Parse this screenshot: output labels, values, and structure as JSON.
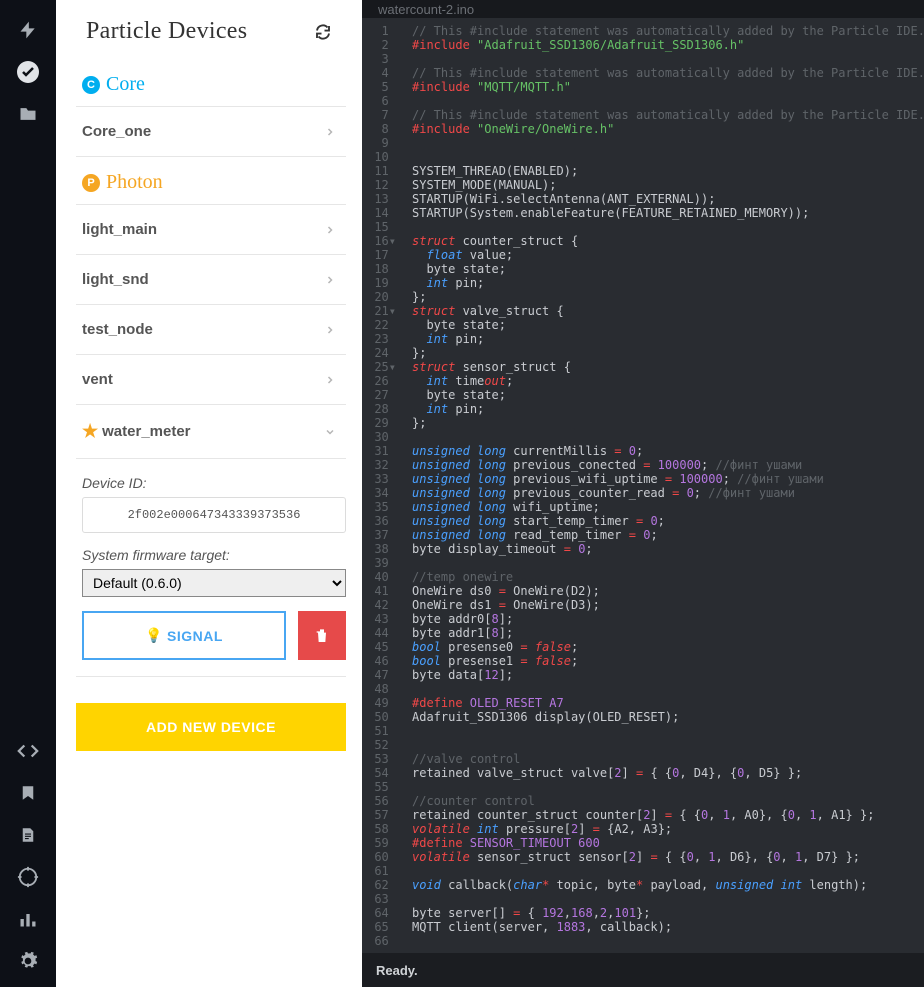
{
  "sidebar": {
    "title": "Particle Devices",
    "platforms": [
      {
        "key": "core",
        "label": "Core",
        "badge": "C",
        "devices": [
          {
            "name": "Core_one",
            "starred": false,
            "expanded": false
          }
        ]
      },
      {
        "key": "photon",
        "label": "Photon",
        "badge": "P",
        "devices": [
          {
            "name": "light_main",
            "starred": false,
            "expanded": false
          },
          {
            "name": "light_snd",
            "starred": false,
            "expanded": false
          },
          {
            "name": "test_node",
            "starred": false,
            "expanded": false
          },
          {
            "name": "vent",
            "starred": false,
            "expanded": false
          },
          {
            "name": "water_meter",
            "starred": true,
            "expanded": true
          }
        ]
      }
    ],
    "device_detail": {
      "device_id_label": "Device ID:",
      "device_id": "2f002e000647343339373536",
      "firmware_label": "System firmware target:",
      "firmware_value": "Default (0.6.0)",
      "signal_label": "SIGNAL",
      "add_label": "ADD NEW DEVICE"
    }
  },
  "editor": {
    "tab_title": "watercount-2.ino",
    "status": "Ready.",
    "code_lines": [
      {
        "n": 1,
        "seg": [
          [
            "c-comment",
            "// This #include statement was automatically added by the Particle IDE."
          ]
        ]
      },
      {
        "n": 2,
        "seg": [
          [
            "c-include",
            "#include "
          ],
          [
            "c-string",
            "\"Adafruit_SSD1306/Adafruit_SSD1306.h\""
          ]
        ]
      },
      {
        "n": 3,
        "seg": []
      },
      {
        "n": 4,
        "seg": [
          [
            "c-comment",
            "// This #include statement was automatically added by the Particle IDE."
          ]
        ]
      },
      {
        "n": 5,
        "seg": [
          [
            "c-include",
            "#include "
          ],
          [
            "c-string",
            "\"MQTT/MQTT.h\""
          ]
        ]
      },
      {
        "n": 6,
        "seg": []
      },
      {
        "n": 7,
        "seg": [
          [
            "c-comment",
            "// This #include statement was automatically added by the Particle IDE."
          ]
        ]
      },
      {
        "n": 8,
        "seg": [
          [
            "c-include",
            "#include "
          ],
          [
            "c-string",
            "\"OneWire/OneWire.h\""
          ]
        ]
      },
      {
        "n": 9,
        "seg": []
      },
      {
        "n": 10,
        "seg": []
      },
      {
        "n": 11,
        "seg": [
          [
            "",
            "SYSTEM_THREAD(ENABLED);"
          ]
        ]
      },
      {
        "n": 12,
        "seg": [
          [
            "",
            "SYSTEM_MODE(MANUAL);"
          ]
        ]
      },
      {
        "n": 13,
        "seg": [
          [
            "",
            "STARTUP(WiFi.selectAntenna(ANT_EXTERNAL));"
          ]
        ]
      },
      {
        "n": 14,
        "seg": [
          [
            "",
            "STARTUP(System.enableFeature(FEATURE_RETAINED_MEMORY));"
          ]
        ]
      },
      {
        "n": 15,
        "seg": []
      },
      {
        "n": 16,
        "fold": true,
        "seg": [
          [
            "c-keyword",
            "struct"
          ],
          [
            "",
            " counter_struct {"
          ]
        ]
      },
      {
        "n": 17,
        "seg": [
          [
            "",
            "  "
          ],
          [
            "c-type",
            "float"
          ],
          [
            "",
            " value;"
          ]
        ]
      },
      {
        "n": 18,
        "seg": [
          [
            "",
            "  byte state;"
          ]
        ]
      },
      {
        "n": 19,
        "seg": [
          [
            "",
            "  "
          ],
          [
            "c-type",
            "int"
          ],
          [
            "",
            " pin;"
          ]
        ]
      },
      {
        "n": 20,
        "seg": [
          [
            "",
            "};"
          ]
        ]
      },
      {
        "n": 21,
        "fold": true,
        "seg": [
          [
            "c-keyword",
            "struct"
          ],
          [
            "",
            " valve_struct {"
          ]
        ]
      },
      {
        "n": 22,
        "seg": [
          [
            "",
            "  byte state;"
          ]
        ]
      },
      {
        "n": 23,
        "seg": [
          [
            "",
            "  "
          ],
          [
            "c-type",
            "int"
          ],
          [
            "",
            " pin;"
          ]
        ]
      },
      {
        "n": 24,
        "seg": [
          [
            "",
            "};"
          ]
        ]
      },
      {
        "n": 25,
        "fold": true,
        "seg": [
          [
            "c-keyword",
            "struct"
          ],
          [
            "",
            " sensor_struct {"
          ]
        ]
      },
      {
        "n": 26,
        "seg": [
          [
            "",
            "  "
          ],
          [
            "c-type",
            "int"
          ],
          [
            "",
            " time"
          ],
          [
            "c-keyword",
            "out"
          ],
          [
            "",
            ";"
          ]
        ]
      },
      {
        "n": 27,
        "seg": [
          [
            "",
            "  byte state;"
          ]
        ]
      },
      {
        "n": 28,
        "seg": [
          [
            "",
            "  "
          ],
          [
            "c-type",
            "int"
          ],
          [
            "",
            " pin;"
          ]
        ]
      },
      {
        "n": 29,
        "seg": [
          [
            "",
            "};"
          ]
        ]
      },
      {
        "n": 30,
        "seg": []
      },
      {
        "n": 31,
        "seg": [
          [
            "c-type",
            "unsigned long"
          ],
          [
            "",
            " currentMillis "
          ],
          [
            "c-op",
            "="
          ],
          [
            "",
            " "
          ],
          [
            "c-num",
            "0"
          ],
          [
            "",
            ";"
          ]
        ]
      },
      {
        "n": 32,
        "seg": [
          [
            "c-type",
            "unsigned long"
          ],
          [
            "",
            " previous_conected "
          ],
          [
            "c-op",
            "="
          ],
          [
            "",
            " "
          ],
          [
            "c-num",
            "100000"
          ],
          [
            "",
            "; "
          ],
          [
            "c-comment",
            "//финт ушами"
          ]
        ]
      },
      {
        "n": 33,
        "seg": [
          [
            "c-type",
            "unsigned long"
          ],
          [
            "",
            " previous_wifi_uptime "
          ],
          [
            "c-op",
            "="
          ],
          [
            "",
            " "
          ],
          [
            "c-num",
            "100000"
          ],
          [
            "",
            "; "
          ],
          [
            "c-comment",
            "//финт ушами"
          ]
        ]
      },
      {
        "n": 34,
        "seg": [
          [
            "c-type",
            "unsigned long"
          ],
          [
            "",
            " previous_counter_read "
          ],
          [
            "c-op",
            "="
          ],
          [
            "",
            " "
          ],
          [
            "c-num",
            "0"
          ],
          [
            "",
            "; "
          ],
          [
            "c-comment",
            "//финт ушами"
          ]
        ]
      },
      {
        "n": 35,
        "seg": [
          [
            "c-type",
            "unsigned long"
          ],
          [
            "",
            " wifi_uptime;"
          ]
        ]
      },
      {
        "n": 36,
        "seg": [
          [
            "c-type",
            "unsigned long"
          ],
          [
            "",
            " start_temp_timer "
          ],
          [
            "c-op",
            "="
          ],
          [
            "",
            " "
          ],
          [
            "c-num",
            "0"
          ],
          [
            "",
            ";"
          ]
        ]
      },
      {
        "n": 37,
        "seg": [
          [
            "c-type",
            "unsigned long"
          ],
          [
            "",
            " read_temp_timer "
          ],
          [
            "c-op",
            "="
          ],
          [
            "",
            " "
          ],
          [
            "c-num",
            "0"
          ],
          [
            "",
            ";"
          ]
        ]
      },
      {
        "n": 38,
        "seg": [
          [
            "",
            "byte display_timeout "
          ],
          [
            "c-op",
            "="
          ],
          [
            "",
            " "
          ],
          [
            "c-num",
            "0"
          ],
          [
            "",
            ";"
          ]
        ]
      },
      {
        "n": 39,
        "seg": []
      },
      {
        "n": 40,
        "seg": [
          [
            "c-comment",
            "//temp onewire"
          ]
        ]
      },
      {
        "n": 41,
        "seg": [
          [
            "",
            "OneWire ds0 "
          ],
          [
            "c-op",
            "="
          ],
          [
            "",
            " OneWire(D2);"
          ]
        ]
      },
      {
        "n": 42,
        "seg": [
          [
            "",
            "OneWire ds1 "
          ],
          [
            "c-op",
            "="
          ],
          [
            "",
            " OneWire(D3);"
          ]
        ]
      },
      {
        "n": 43,
        "seg": [
          [
            "",
            "byte addr0["
          ],
          [
            "c-num",
            "8"
          ],
          [
            "",
            "];"
          ]
        ]
      },
      {
        "n": 44,
        "seg": [
          [
            "",
            "byte addr1["
          ],
          [
            "c-num",
            "8"
          ],
          [
            "",
            "];"
          ]
        ]
      },
      {
        "n": 45,
        "seg": [
          [
            "c-type",
            "bool"
          ],
          [
            "",
            " presense0 "
          ],
          [
            "c-op",
            "="
          ],
          [
            "",
            " "
          ],
          [
            "c-keyword",
            "false"
          ],
          [
            "",
            ";"
          ]
        ]
      },
      {
        "n": 46,
        "seg": [
          [
            "c-type",
            "bool"
          ],
          [
            "",
            " presense1 "
          ],
          [
            "c-op",
            "="
          ],
          [
            "",
            " "
          ],
          [
            "c-keyword",
            "false"
          ],
          [
            "",
            ";"
          ]
        ]
      },
      {
        "n": 47,
        "seg": [
          [
            "",
            "byte data["
          ],
          [
            "c-num",
            "12"
          ],
          [
            "",
            "];"
          ]
        ]
      },
      {
        "n": 48,
        "seg": []
      },
      {
        "n": 49,
        "seg": [
          [
            "c-define",
            "#define "
          ],
          [
            "c-num",
            "OLED_RESET A7"
          ]
        ]
      },
      {
        "n": 50,
        "seg": [
          [
            "",
            "Adafruit_SSD1306 display(OLED_RESET);"
          ]
        ]
      },
      {
        "n": 51,
        "seg": []
      },
      {
        "n": 52,
        "seg": []
      },
      {
        "n": 53,
        "seg": [
          [
            "c-comment",
            "//valve control"
          ]
        ]
      },
      {
        "n": 54,
        "seg": [
          [
            "",
            "retained valve_struct valve["
          ],
          [
            "c-num",
            "2"
          ],
          [
            "",
            "] "
          ],
          [
            "c-op",
            "="
          ],
          [
            "",
            " { {"
          ],
          [
            "c-num",
            "0"
          ],
          [
            "",
            ", D4}, {"
          ],
          [
            "c-num",
            "0"
          ],
          [
            "",
            ", D5} };"
          ]
        ]
      },
      {
        "n": 55,
        "seg": []
      },
      {
        "n": 56,
        "seg": [
          [
            "c-comment",
            "//counter control"
          ]
        ]
      },
      {
        "n": 57,
        "seg": [
          [
            "",
            "retained counter_struct counter["
          ],
          [
            "c-num",
            "2"
          ],
          [
            "",
            "] "
          ],
          [
            "c-op",
            "="
          ],
          [
            "",
            " { {"
          ],
          [
            "c-num",
            "0"
          ],
          [
            "",
            ", "
          ],
          [
            "c-num",
            "1"
          ],
          [
            "",
            ", A0}, {"
          ],
          [
            "c-num",
            "0"
          ],
          [
            "",
            ", "
          ],
          [
            "c-num",
            "1"
          ],
          [
            "",
            ", A1} };"
          ]
        ]
      },
      {
        "n": 58,
        "seg": [
          [
            "c-keyword",
            "volatile"
          ],
          [
            "",
            " "
          ],
          [
            "c-type",
            "int"
          ],
          [
            "",
            " pressure["
          ],
          [
            "c-num",
            "2"
          ],
          [
            "",
            "] "
          ],
          [
            "c-op",
            "="
          ],
          [
            "",
            " {A2, A3};"
          ]
        ]
      },
      {
        "n": 59,
        "seg": [
          [
            "c-define",
            "#define "
          ],
          [
            "c-num",
            "SENSOR_TIMEOUT 600"
          ]
        ]
      },
      {
        "n": 60,
        "seg": [
          [
            "c-keyword",
            "volatile"
          ],
          [
            "",
            " sensor_struct sensor["
          ],
          [
            "c-num",
            "2"
          ],
          [
            "",
            "] "
          ],
          [
            "c-op",
            "="
          ],
          [
            "",
            " { {"
          ],
          [
            "c-num",
            "0"
          ],
          [
            "",
            ", "
          ],
          [
            "c-num",
            "1"
          ],
          [
            "",
            ", D6}, {"
          ],
          [
            "c-num",
            "0"
          ],
          [
            "",
            ", "
          ],
          [
            "c-num",
            "1"
          ],
          [
            "",
            ", D7} };"
          ]
        ]
      },
      {
        "n": 61,
        "seg": []
      },
      {
        "n": 62,
        "seg": [
          [
            "c-type",
            "void"
          ],
          [
            "",
            " callback("
          ],
          [
            "c-type",
            "char"
          ],
          [
            "c-op",
            "*"
          ],
          [
            "",
            " topic, byte"
          ],
          [
            "c-op",
            "*"
          ],
          [
            "",
            " payload, "
          ],
          [
            "c-type",
            "unsigned int"
          ],
          [
            "",
            " length);"
          ]
        ]
      },
      {
        "n": 63,
        "seg": []
      },
      {
        "n": 64,
        "seg": [
          [
            "",
            "byte server[] "
          ],
          [
            "c-op",
            "="
          ],
          [
            "",
            " { "
          ],
          [
            "c-num",
            "192"
          ],
          [
            "",
            ","
          ],
          [
            "c-num",
            "168"
          ],
          [
            "",
            ","
          ],
          [
            "c-num",
            "2"
          ],
          [
            "",
            ","
          ],
          [
            "c-num",
            "101"
          ],
          [
            "",
            "};"
          ]
        ]
      },
      {
        "n": 65,
        "seg": [
          [
            "",
            "MQTT client(server, "
          ],
          [
            "c-num",
            "1883"
          ],
          [
            "",
            ", callback);"
          ]
        ]
      },
      {
        "n": 66,
        "seg": []
      }
    ]
  },
  "rail_icons": [
    "flash",
    "check",
    "folder",
    "code",
    "bookmark",
    "file",
    "target",
    "bars",
    "gear"
  ]
}
